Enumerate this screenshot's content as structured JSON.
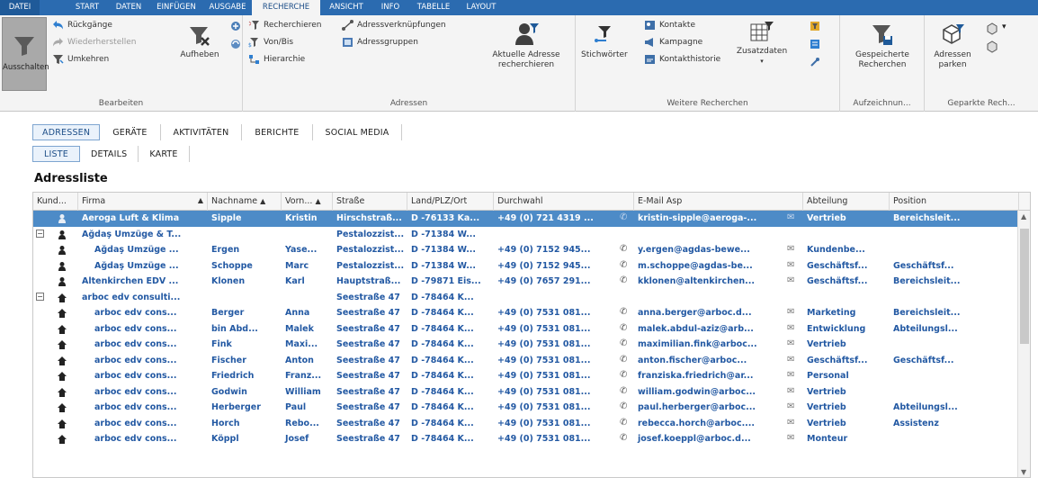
{
  "ribbon_tabs": [
    "DATEI",
    "START",
    "DATEN",
    "EINFÜGEN",
    "AUSGABE",
    "RECHERCHE",
    "ANSICHT",
    "INFO",
    "TABELLE",
    "LAYOUT"
  ],
  "ribbon": {
    "ausschalten": "Ausschalten",
    "rueckgaenge": "Rückgänge",
    "wiederherstellen": "Wiederherstellen",
    "umkehren": "Umkehren",
    "aufheben": "Aufheben",
    "group_bearbeiten": "Bearbeiten",
    "recherchieren": "Recherchieren",
    "adressverknuepfungen": "Adressverknüpfungen",
    "vonbis": "Von/Bis",
    "adressgruppen": "Adressgruppen",
    "hierarchie": "Hierarchie",
    "aktuelle_adresse": "Aktuelle Adresse",
    "recherchieren2": "recherchieren",
    "group_adressen": "Adressen",
    "stichwoerter": "Stichwörter",
    "kontakte": "Kontakte",
    "kampagne": "Kampagne",
    "kontakthistorie": "Kontakthistorie",
    "zusatzdaten": "Zusatzdaten",
    "group_weitere": "Weitere Recherchen",
    "gespeicherte": "Gespeicherte",
    "recherchen": "Recherchen",
    "group_aufzeichnung": "Aufzeichnun...",
    "adressen_parken1": "Adressen",
    "adressen_parken2": "parken",
    "group_geparkte": "Geparkte Rech..."
  },
  "view_tabs": [
    "ADRESSEN",
    "GERÄTE",
    "AKTIVITÄTEN",
    "BERICHTE",
    "SOCIAL MEDIA"
  ],
  "sub_tabs": [
    "LISTE",
    "DETAILS",
    "KARTE"
  ],
  "list_title": "Adressliste",
  "columns": [
    "Kund...",
    "Firma",
    "Nachname",
    "Vorn...",
    "Straße",
    "Land/PLZ/Ort",
    "Durchwahl",
    "E-Mail Asp",
    "Abteilung",
    "Position"
  ],
  "rows": [
    {
      "firma": "Aeroga Luft & Klima",
      "nachname": "Sipple",
      "vorname": "Kristin",
      "strasse": "Hirschstraß...",
      "ort": "D -76133 Ka...",
      "durchwahl": "+49 (0) 721 4319 ...",
      "email": "kristin-sipple@aeroga-...",
      "abteilung": "Vertrieb",
      "position": "Bereichsleit..."
    },
    {
      "firma": "Ağdaş Umzüge & T...",
      "nachname": "",
      "vorname": "",
      "strasse": "Pestalozzist...",
      "ort": "D -71384 W...",
      "durchwahl": "",
      "email": "",
      "abteilung": "",
      "position": ""
    },
    {
      "firma": "Ağdaş Umzüge ...",
      "nachname": "Ergen",
      "vorname": "Yase...",
      "strasse": "Pestalozzist...",
      "ort": "D -71384 W...",
      "durchwahl": "+49 (0) 7152 945...",
      "email": "y.ergen@agdas-bewe...",
      "abteilung": "Kundenbe...",
      "position": ""
    },
    {
      "firma": "Ağdaş Umzüge ...",
      "nachname": "Schoppe",
      "vorname": "Marc",
      "strasse": "Pestalozzist...",
      "ort": "D -71384 W...",
      "durchwahl": "+49 (0) 7152 945...",
      "email": "m.schoppe@agdas-be...",
      "abteilung": "Geschäftsf...",
      "position": "Geschäftsf..."
    },
    {
      "firma": "Altenkirchen EDV ...",
      "nachname": "Klonen",
      "vorname": "Karl",
      "strasse": "Hauptstraß...",
      "ort": "D -79871 Eis...",
      "durchwahl": "+49 (0) 7657 291...",
      "email": "kklonen@altenkirchen...",
      "abteilung": "Geschäftsf...",
      "position": "Bereichsleit..."
    },
    {
      "firma": "arboc edv consulti...",
      "nachname": "",
      "vorname": "",
      "strasse": "Seestraße 47",
      "ort": "D -78464 K...",
      "durchwahl": "",
      "email": "",
      "abteilung": "",
      "position": ""
    },
    {
      "firma": "arboc edv cons...",
      "nachname": "Berger",
      "vorname": "Anna",
      "strasse": "Seestraße 47",
      "ort": "D -78464 K...",
      "durchwahl": "+49 (0) 7531 081...",
      "email": "anna.berger@arboc.d...",
      "abteilung": "Marketing",
      "position": "Bereichsleit..."
    },
    {
      "firma": "arboc edv cons...",
      "nachname": "bin Abd...",
      "vorname": "Malek",
      "strasse": "Seestraße 47",
      "ort": "D -78464 K...",
      "durchwahl": "+49 (0) 7531 081...",
      "email": "malek.abdul-aziz@arb...",
      "abteilung": "Entwicklung",
      "position": "Abteilungsl..."
    },
    {
      "firma": "arboc edv cons...",
      "nachname": "Fink",
      "vorname": "Maxi...",
      "strasse": "Seestraße 47",
      "ort": "D -78464 K...",
      "durchwahl": "+49 (0) 7531 081...",
      "email": "maximilian.fink@arboc...",
      "abteilung": "Vertrieb",
      "position": ""
    },
    {
      "firma": "arboc edv cons...",
      "nachname": "Fischer",
      "vorname": "Anton",
      "strasse": "Seestraße 47",
      "ort": "D -78464 K...",
      "durchwahl": "+49 (0) 7531 081...",
      "email": "anton.fischer@arboc...",
      "abteilung": "Geschäftsf...",
      "position": "Geschäftsf..."
    },
    {
      "firma": "arboc edv cons...",
      "nachname": "Friedrich",
      "vorname": "Franz...",
      "strasse": "Seestraße 47",
      "ort": "D -78464 K...",
      "durchwahl": "+49 (0) 7531 081...",
      "email": "franziska.friedrich@ar...",
      "abteilung": "Personal",
      "position": ""
    },
    {
      "firma": "arboc edv cons...",
      "nachname": "Godwin",
      "vorname": "William",
      "strasse": "Seestraße 47",
      "ort": "D -78464 K...",
      "durchwahl": "+49 (0) 7531 081...",
      "email": "william.godwin@arboc...",
      "abteilung": "Vertrieb",
      "position": ""
    },
    {
      "firma": "arboc edv cons...",
      "nachname": "Herberger",
      "vorname": "Paul",
      "strasse": "Seestraße 47",
      "ort": "D -78464 K...",
      "durchwahl": "+49 (0) 7531 081...",
      "email": "paul.herberger@arboc...",
      "abteilung": "Vertrieb",
      "position": "Abteilungsl..."
    },
    {
      "firma": "arboc edv cons...",
      "nachname": "Horch",
      "vorname": "Rebo...",
      "strasse": "Seestraße 47",
      "ort": "D -78464 K...",
      "durchwahl": "+49 (0) 7531 081...",
      "email": "rebecca.horch@arboc....",
      "abteilung": "Vertrieb",
      "position": "Assistenz"
    },
    {
      "firma": "arboc edv cons...",
      "nachname": "Köppl",
      "vorname": "Josef",
      "strasse": "Seestraße 47",
      "ort": "D -78464 K...",
      "durchwahl": "+49 (0) 7531 081...",
      "email": "josef.koeppl@arboc.d...",
      "abteilung": "Monteur",
      "position": ""
    }
  ],
  "colors": {
    "ribbon_bar": "#2b6bb0",
    "selected_row": "#4d8bc7",
    "row_text": "#2359a3"
  }
}
